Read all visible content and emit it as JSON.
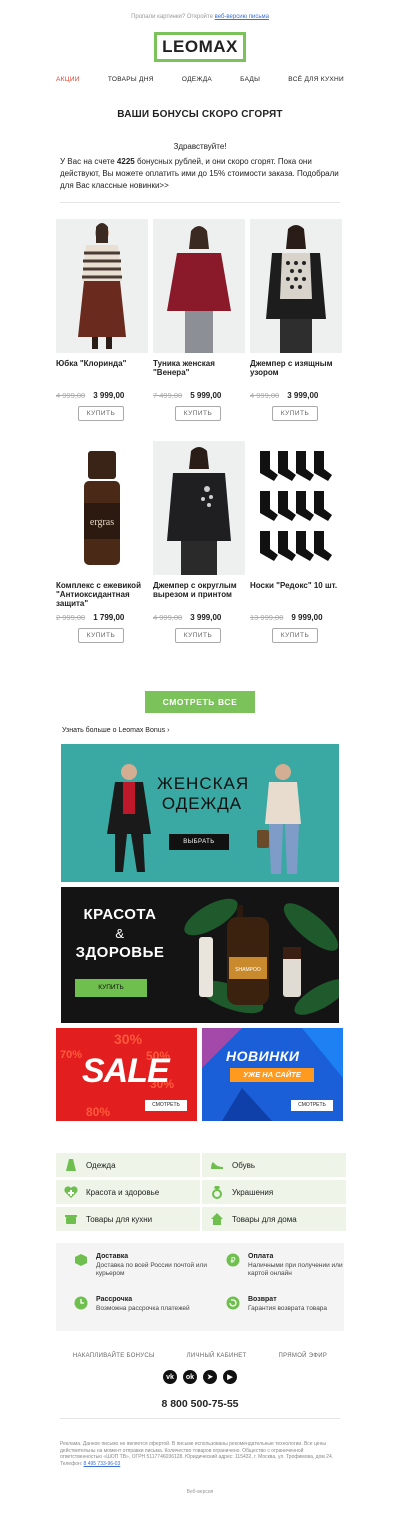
{
  "preheader": {
    "text": "Пропали картинки? Откройте",
    "link": "веб-версию письма"
  },
  "logo": "LEOMAX",
  "nav": [
    "АКЦИИ",
    "ТОВАРЫ ДНЯ",
    "ОДЕЖДА",
    "БАДЫ",
    "ВСЁ ДЛЯ КУХНИ"
  ],
  "hero_title": "ВАШИ БОНУСЫ СКОРО СГОРЯТ",
  "greeting": "Здравствуйте!",
  "intro": {
    "before": "У Вас на счете ",
    "amount": "4225",
    "after": " бонусных рублей, и они скоро сгорят. Пока они действуют, Вы можете оплатить ими до 15% стоимости заказа. Подобрали для Вас классные новинки>>"
  },
  "products": [
    {
      "name": "Юбка \"Клоринда\"",
      "old": "4 999,00",
      "new": "3 999,00",
      "buy": "КУПИТЬ"
    },
    {
      "name": "Туника женская \"Венера\"",
      "old": "7 499,00",
      "new": "5 999,00",
      "buy": "КУПИТЬ"
    },
    {
      "name": "Джемпер с изящным узором",
      "old": "4 999,00",
      "new": "3 999,00",
      "buy": "КУПИТЬ"
    },
    {
      "name": "Комплекс с ежевикой \"Антиоксидантная защита\"",
      "old": "2 999,00",
      "new": "1 799,00",
      "buy": "КУПИТЬ"
    },
    {
      "name": "Джемпер с округлым вырезом и принтом",
      "old": "4 999,00",
      "new": "3 999,00",
      "buy": "КУПИТЬ"
    },
    {
      "name": "Носки \"Редокс\" 10 шт.",
      "old": "13 999,00",
      "new": "9 999,00",
      "buy": "КУПИТЬ"
    }
  ],
  "bottle_label": "ergras",
  "cta": "СМОТРЕТЬ ВСЕ",
  "more_link": "Узнать больше о Leomax Bonus",
  "banners": {
    "women": {
      "title_1": "ЖЕНСКАЯ",
      "title_2": "ОДЕЖДА",
      "button": "ВЫБРАТЬ"
    },
    "beauty": {
      "title_1": "КРАСОТА",
      "amp": "&",
      "title_2": "ЗДОРОВЬЕ",
      "button": "КУПИТЬ",
      "product_label": "SHAMPOO"
    },
    "sale": {
      "text": "SALE",
      "button": "СМОТРЕТЬ"
    },
    "new": {
      "title": "НОВИНКИ",
      "subtitle": "УЖЕ НА САЙТЕ",
      "button": "СМОТРЕТЬ"
    }
  },
  "categories": [
    "Одежда",
    "Обувь",
    "Красота и здоровье",
    "Украшения",
    "Товары для кухни",
    "Товары для дома"
  ],
  "info": [
    {
      "title": "Доставка",
      "text": "Доставка по всей России почтой или курьером"
    },
    {
      "title": "Оплата",
      "text": "Наличными при получении или картой онлайн"
    },
    {
      "title": "Рассрочка",
      "text": "Возможна рассрочка платежей"
    },
    {
      "title": "Возврат",
      "text": "Гарантия возврата товара"
    }
  ],
  "footer_links": [
    "НАКАПЛИВАЙТЕ БОНУСЫ",
    "ЛИЧНЫЙ КАБИНЕТ",
    "ПРЯМОЙ ЭФИР"
  ],
  "social": [
    "vk",
    "ok",
    "tg",
    "yt"
  ],
  "phone": "8 800 500-75-55",
  "legal": {
    "text": "Реклама. Данное письмо не является офертой. В письме использованы рекомендательные технологии. Все цены действительны на момент отправки письма. Количество товаров ограничено. Общество с ограниченной ответственностью «ШОП ТВ», ОГРН 5117746036128. Юридический адрес: 115432, г. Москва, ул. Трофимова, дом 24. Телефон: ",
    "phone": "8 495 733-96-03"
  },
  "web_version": "Веб-версия",
  "colors": {
    "accent": "#7cc25b",
    "nav_active": "#e0402f"
  }
}
